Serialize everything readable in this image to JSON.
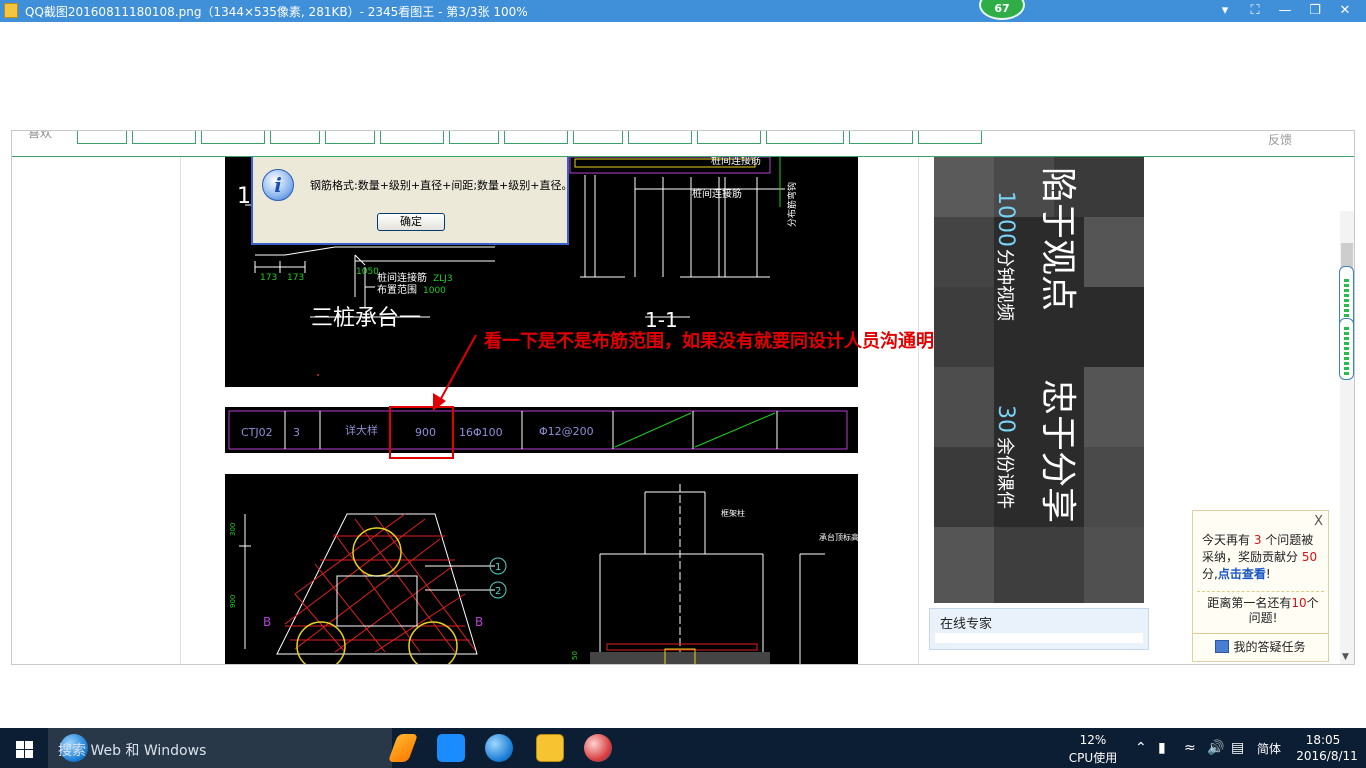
{
  "viewer": {
    "title": "QQ截图20160811180108.png（1344×535像素, 281KB）- 2345看图王 - 第3/3张 100%",
    "badge": "67",
    "controls": {
      "dropdown": "▾",
      "fullscreen": "⛶",
      "restore": "❐",
      "close": "✕"
    }
  },
  "page": {
    "nav_cut_text": "喜欢",
    "feedback": "反馈"
  },
  "cad": {
    "top_labels": {
      "section_num": "1",
      "title_left": "三桩承台一",
      "title_right": "1-1",
      "dim_173a": "173",
      "dim_173b": "173",
      "dim_1050": "1050",
      "lian_jie": "桩间连接筋",
      "lian_jie_code": "ZLJ3",
      "bu_zhi": "布置范围",
      "bu_zhi_val": "1000",
      "lian_jie_right": "桩间连接筋",
      "fen_bu": "分布筋弯钩",
      "top_right_label": "桩间连接筋"
    },
    "table_row": [
      "CTJ02",
      "3",
      "详大样",
      "900",
      "16Φ100",
      "Φ12@200"
    ],
    "bottom_labels": {
      "b_left": "B",
      "b_right": "B",
      "circle1": "1",
      "circle2": "2",
      "jiazhu": "框架柱",
      "cheng_tai": "承台顶标高",
      "dim_300": "300",
      "dim_900": "900",
      "dim_50": "50"
    }
  },
  "dialog": {
    "message": "钢筋格式:数量+级别+直径+间距;数量+级别+直径。",
    "ok_label": "确定"
  },
  "annotation": {
    "text": "看一下是不是布筋范围，如果没有就要同设计人员沟通明确布筋范围",
    "color": "#e00000"
  },
  "ad": {
    "num1": "1000",
    "line1_rest": "分钟视频",
    "big1": "陷于观点",
    "num2": "30",
    "line2_rest": "余份课件",
    "big2": "忠于分享"
  },
  "expert_panel": {
    "label": "在线专家"
  },
  "popup": {
    "close": "X",
    "p1_a": "今天再有 ",
    "p1_count": "3",
    "p1_b": " 个问题被采纳，奖励贡献分 ",
    "p1_points": "50",
    "p1_c": " 分,",
    "p1_link": "点击查看",
    "p1_d": "!",
    "p2_a": "距离第一名还有",
    "p2_count": "10",
    "p2_b": "个问题!",
    "task": "我的答疑任务"
  },
  "taskbar": {
    "search_text": "搜索 Web 和 Windows",
    "cpu_percent": "12%",
    "cpu_label": "CPU使用",
    "lang": "简体",
    "time": "18:05",
    "date": "2016/8/11"
  },
  "colors": {
    "titlebar": "#3f8fd9",
    "cad_bg": "#000000",
    "cad_line": "#ffffff",
    "cad_green": "#1dd11d",
    "cad_purple": "#b93fd6",
    "cad_red": "#e02020",
    "taskbar": "#0c1e33"
  }
}
